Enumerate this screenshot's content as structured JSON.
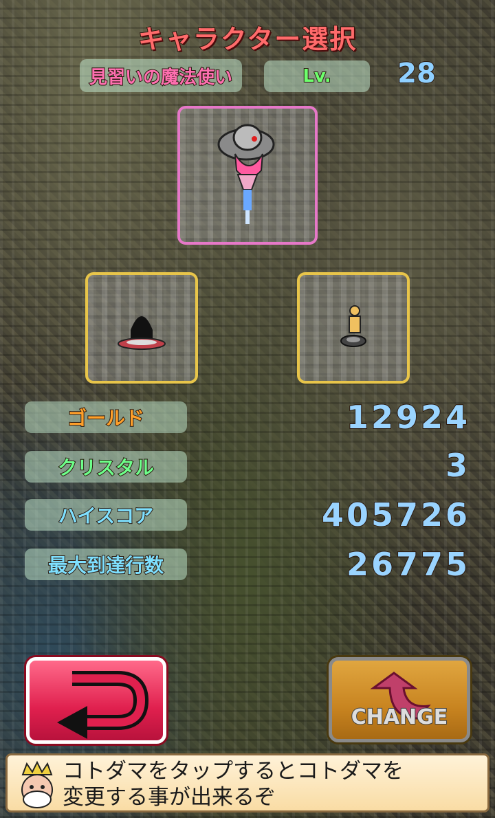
{
  "screen": {
    "title": "キャラクター選択"
  },
  "character": {
    "name": "見習いの魔法使い",
    "level_label": "Lv.",
    "level": "28"
  },
  "slots": {
    "main": "witch-character-icon",
    "left": "shadow-character-icon",
    "right": "hero-character-icon"
  },
  "stats": {
    "gold_label": "ゴールド",
    "gold": "12924",
    "crystal_label": "クリスタル",
    "crystal": "3",
    "hiscore_label": "ハイスコア",
    "hiscore": "405726",
    "maxrows_label": "最大到達行数",
    "maxrows": "26775"
  },
  "buttons": {
    "back_icon": "u-turn-arrow-icon",
    "change_label": "CHANGE"
  },
  "message": {
    "text": "コトダマをタップするとコトダマを\n変更する事が出来るぞ"
  },
  "colors": {
    "title": "#ff6b6b",
    "gold": "#ffa02a",
    "crystal": "#6dff8a",
    "value": "#9ad4ff",
    "back": "#e0204e",
    "change": "#c88420"
  }
}
